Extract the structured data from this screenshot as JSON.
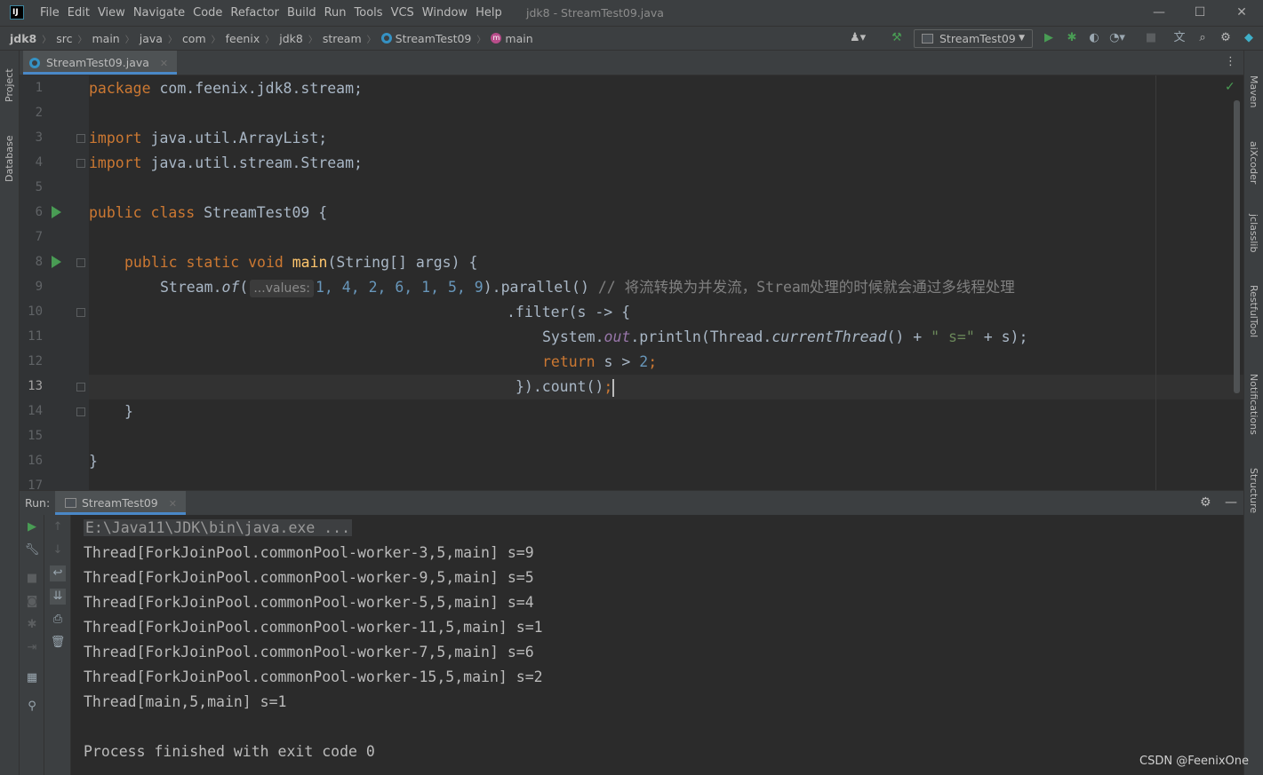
{
  "app": {
    "logo_text": "IJ",
    "window_title": "jdk8 - StreamTest09.java",
    "menu": [
      "File",
      "Edit",
      "View",
      "Navigate",
      "Code",
      "Refactor",
      "Build",
      "Run",
      "Tools",
      "VCS",
      "Window",
      "Help"
    ],
    "window_controls": {
      "minimize": "—",
      "maximize": "☐",
      "close": "✕"
    }
  },
  "breadcrumb": [
    "jdk8",
    "src",
    "main",
    "java",
    "com",
    "feenix",
    "jdk8",
    "stream",
    "StreamTest09",
    "main"
  ],
  "toolbar": {
    "run_config": "StreamTest09",
    "icons": [
      "user-icon",
      "build-hammer-icon",
      "run-icon",
      "debug-icon",
      "coverage-icon",
      "profile-icon",
      "stop-icon",
      "translate-icon",
      "search-icon",
      "settings-icon",
      "plugin-icon"
    ]
  },
  "left_stripe": [
    "Project",
    "Database"
  ],
  "right_stripe": [
    "Maven",
    "aiXcoder",
    "jclasslib",
    "RestfulTool",
    "Notifications",
    "Structure"
  ],
  "editor": {
    "tab": "StreamTest09.java",
    "tab_close": "✕",
    "line_numbers": [
      "1",
      "2",
      "3",
      "4",
      "5",
      "6",
      "7",
      "8",
      "9",
      "10",
      "11",
      "12",
      "13",
      "14",
      "15",
      "16",
      "17"
    ],
    "current_line": 13,
    "param_hint": "...values:",
    "code": {
      "l1_kw": "package",
      "l1_rest": " com.feenix.jdk8.stream;",
      "l3_kw": "import",
      "l3_rest": " java.util.ArrayList;",
      "l4_kw": "import",
      "l4_rest": " java.util.stream.Stream;",
      "l6_kw": "public class",
      "l6_rest": " StreamTest09 {",
      "l8_kw": "public static void",
      "l8_fn": "main",
      "l8_rest": "(String[] args) {",
      "l9_a": "Stream.",
      "l9_of": "of",
      "l9_b": "(",
      "l9_nums": "1, 4, 2, 6, 1, 5, 9",
      "l9_c": ").parallel() ",
      "l9_cmt": "// 将流转换为并发流，Stream处理的时候就会通过多线程处理",
      "l10": ".filter(s -> {",
      "l11_a": "System.",
      "l11_out": "out",
      "l11_b": ".println(Thread.",
      "l11_ct": "currentThread",
      "l11_c": "() + ",
      "l11_str": "\" s=\"",
      "l11_d": " + s);",
      "l12_kw": "return",
      "l12_rest": " s > ",
      "l12_num": "2",
      "l12_end": ";",
      "l13": "}).count()",
      "l13_end": ";",
      "l14": "}",
      "l16": "}"
    }
  },
  "run_window": {
    "label": "Run:",
    "tab": "StreamTest09",
    "tab_close": "✕",
    "console": {
      "command": "E:\\Java11\\JDK\\bin\\java.exe ...",
      "lines": [
        "Thread[ForkJoinPool.commonPool-worker-3,5,main] s=9",
        "Thread[ForkJoinPool.commonPool-worker-9,5,main] s=5",
        "Thread[ForkJoinPool.commonPool-worker-5,5,main] s=4",
        "Thread[ForkJoinPool.commonPool-worker-11,5,main] s=1",
        "Thread[ForkJoinPool.commonPool-worker-7,5,main] s=6",
        "Thread[ForkJoinPool.commonPool-worker-15,5,main] s=2",
        "Thread[main,5,main] s=1"
      ],
      "exit": "Process finished with exit code 0"
    }
  },
  "watermark": "CSDN @FeenixOne",
  "colors": {
    "keyword": "#cc7832",
    "function": "#ffc66d",
    "number": "#6897bb",
    "string": "#6a8759",
    "comment": "#808080",
    "field": "#9876aa",
    "run_green": "#499c54",
    "accent": "#4a88c7"
  }
}
